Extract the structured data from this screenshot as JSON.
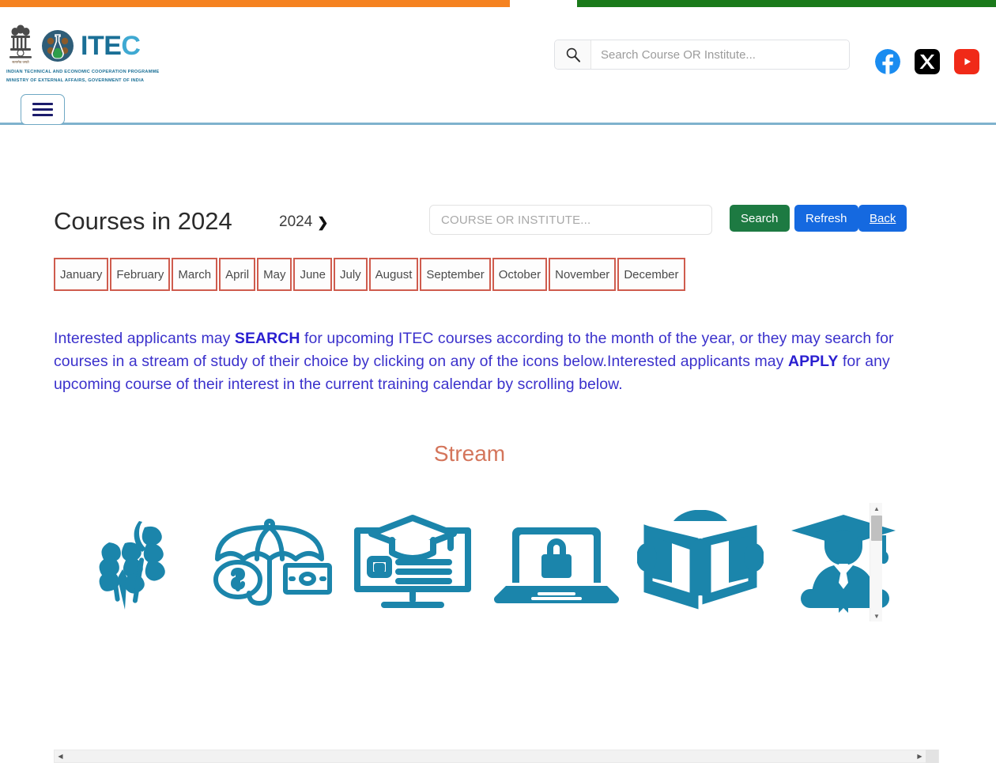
{
  "topbar": {
    "saffron_color": "#f58220",
    "green_color": "#1b7a1b"
  },
  "header": {
    "brand": {
      "wordmark_main": "ITE",
      "wordmark_accent": "C",
      "subtitle_line1": "INDIAN TECHNICAL AND ECONOMIC COOPERATION PROGRAMME",
      "subtitle_line2": "MINISTRY OF EXTERNAL AFFAIRS, GOVERNMENT OF INDIA",
      "emblem_caption": "सत्यमेव जयते"
    },
    "search": {
      "placeholder": "Search Course OR Institute...",
      "value": ""
    },
    "socials": [
      {
        "name": "facebook",
        "color": "#1a8cf0"
      },
      {
        "name": "x-twitter",
        "color": "#000000"
      },
      {
        "name": "youtube",
        "color": "#f02a18"
      }
    ],
    "menu_label": "Menu"
  },
  "main": {
    "page_title": "Courses in 2024",
    "breadcrumb": {
      "year": "2024",
      "chevron": "❯"
    },
    "course_search": {
      "placeholder": "COURSE OR INSTITUTE...",
      "value": ""
    },
    "buttons": {
      "search": "Search",
      "refresh": "Refresh",
      "back": "Back",
      "search_color": "#1d7a42",
      "refresh_color": "#1569e0",
      "back_color": "#1569e0"
    },
    "months": [
      "January",
      "February",
      "March",
      "April",
      "May",
      "June",
      "July",
      "August",
      "September",
      "October",
      "November",
      "December"
    ],
    "month_border_color": "#cf5c4e",
    "intro": {
      "part1": "Interested applicants may ",
      "kw1": "SEARCH",
      "part2": " for upcoming ITEC courses according to the month of the year, or they may search for courses in a stream of study of their choice by clicking on any of the icons below.Interested applicants may ",
      "kw2": "APPLY",
      "part3": " for any upcoming course of their interest in the current training calendar by scrolling below.",
      "text_color": "#3b31cc"
    },
    "stream": {
      "heading": "Stream",
      "heading_color": "#d4755b",
      "icon_color": "#1b85ab",
      "items": [
        {
          "name": "agriculture-icon",
          "label": "Agriculture"
        },
        {
          "name": "finance-insurance-icon",
          "label": "Finance and Insurance"
        },
        {
          "name": "education-technology-icon",
          "label": "Education Technology"
        },
        {
          "name": "cyber-security-icon",
          "label": "Cyber Security"
        },
        {
          "name": "open-book-icon",
          "label": "General Studies"
        },
        {
          "name": "graduate-icon",
          "label": "Higher Education"
        }
      ]
    }
  },
  "scrollbars": {
    "vertical": {
      "up": "▲",
      "down": "▼"
    },
    "horizontal": {
      "left": "◀",
      "right": "▶"
    }
  }
}
